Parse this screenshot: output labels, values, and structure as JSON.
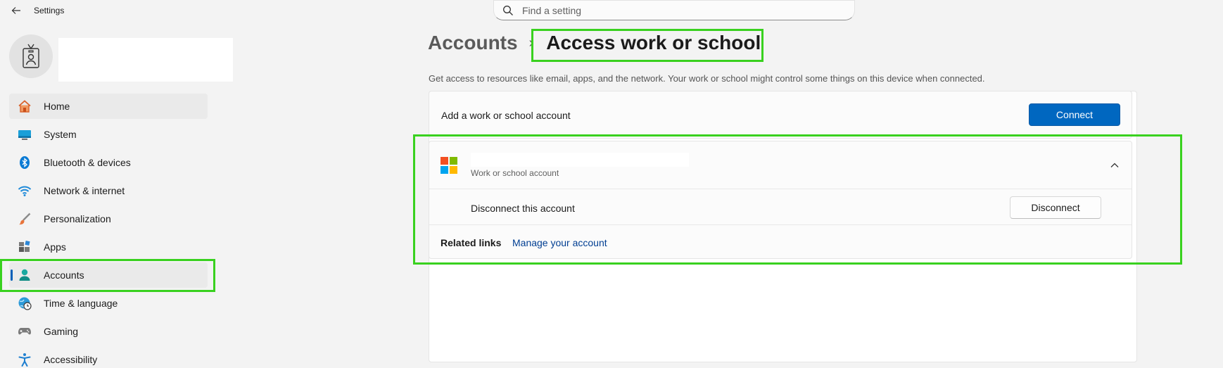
{
  "app": {
    "title": "Settings",
    "back_icon": "back-arrow-icon"
  },
  "search": {
    "placeholder": "Find a setting",
    "value": "",
    "icon": "search-icon"
  },
  "user": {
    "avatar_icon": "id-badge-icon",
    "name": ""
  },
  "sidebar": {
    "items": [
      {
        "label": "Home",
        "icon": "home-icon",
        "selected": false,
        "hovered": true
      },
      {
        "label": "System",
        "icon": "monitor-icon",
        "selected": false
      },
      {
        "label": "Bluetooth & devices",
        "icon": "bluetooth-icon",
        "selected": false
      },
      {
        "label": "Network & internet",
        "icon": "wifi-icon",
        "selected": false
      },
      {
        "label": "Personalization",
        "icon": "brush-icon",
        "selected": false
      },
      {
        "label": "Apps",
        "icon": "apps-icon",
        "selected": false
      },
      {
        "label": "Accounts",
        "icon": "person-icon",
        "selected": true
      },
      {
        "label": "Time & language",
        "icon": "globe-clock-icon",
        "selected": false
      },
      {
        "label": "Gaming",
        "icon": "gamepad-icon",
        "selected": false
      },
      {
        "label": "Accessibility",
        "icon": "accessibility-icon",
        "selected": false
      }
    ]
  },
  "breadcrumb": {
    "parent": "Accounts",
    "separator": "›",
    "current": "Access work or school"
  },
  "description": "Get access to resources like email, apps, and the network. Your work or school might control some things on this device when connected.",
  "add_account": {
    "label": "Add a work or school account",
    "button": "Connect"
  },
  "account": {
    "name": "",
    "type": "Work or school account",
    "logo_colors": [
      "#f25022",
      "#7fba00",
      "#00a4ef",
      "#ffb900"
    ],
    "expanded": true,
    "disconnect_label": "Disconnect this account",
    "disconnect_button": "Disconnect",
    "related_label": "Related links",
    "manage_link": "Manage your account"
  },
  "colors": {
    "accent": "#0067c0",
    "highlight": "#39d11f",
    "link": "#003e92"
  }
}
